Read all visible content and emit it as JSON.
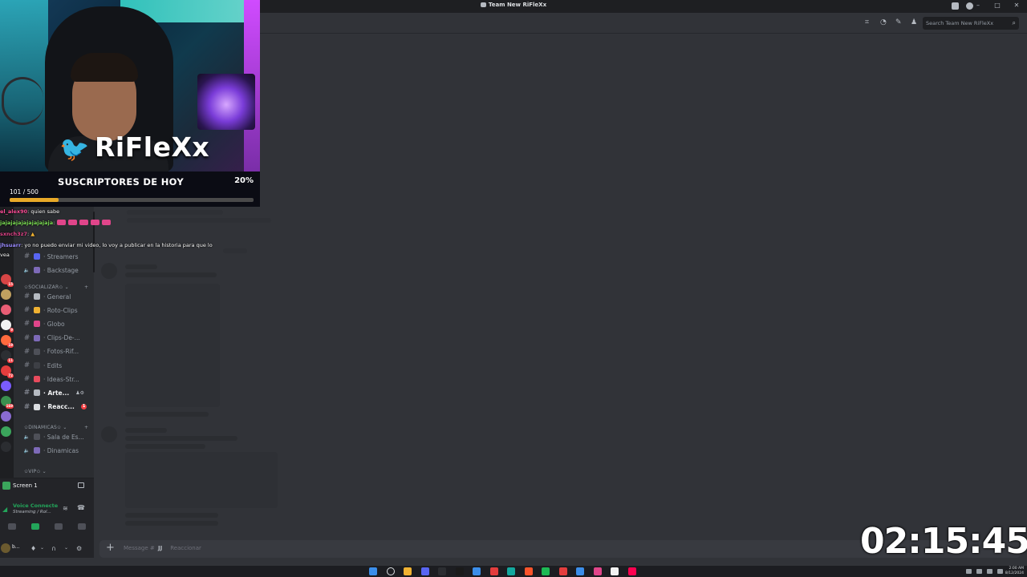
{
  "window": {
    "title": "Team New RiFleXx",
    "minimize_glyph": "–",
    "maximize_glyph": "□",
    "close_glyph": "✕"
  },
  "header": {
    "search_placeholder": "Search Team New RiFleXx",
    "icons": [
      "threads-icon",
      "bell-icon",
      "pin-icon",
      "members-icon"
    ]
  },
  "stream_overlay": {
    "handle": "RiFleXx",
    "sub_goal_title": "SUSCRIPTORES DE HOY",
    "sub_goal_count": "101 / 500",
    "sub_goal_percent": "20%",
    "sub_goal_fraction": 0.2
  },
  "twitch_chat": [
    {
      "user": "el_alex90",
      "text": ": quien sabe",
      "color": "#ff4f9a"
    },
    {
      "user": "jajajajajajajajajaja",
      "text": ":",
      "color": "#7cdc55"
    },
    {
      "user": "sxnch3z7",
      "text": ":",
      "color": "#e0458a"
    },
    {
      "user": "jhsuarr",
      "text": ": yo no puedo enviar mi video, lo voy a publicar en la historia para que lo",
      "color": "#9b8cff"
    },
    {
      "user": "",
      "text": "vea",
      "color": "#ffffff"
    }
  ],
  "sidebar": {
    "top_items": [
      {
        "name": "Streamers",
        "type": "text",
        "color": "#5865f2"
      },
      {
        "name": "Backstage",
        "type": "voice",
        "color": "#7d6ab8"
      }
    ],
    "categories": [
      {
        "label": "✩SOCIALIZAR✩",
        "channels": [
          {
            "name": "General",
            "type": "text",
            "color": "#b5bac1"
          },
          {
            "name": "Roto-Clips",
            "type": "text",
            "color": "#f0b232"
          },
          {
            "name": "Globo",
            "type": "text",
            "color": "#e0458a"
          },
          {
            "name": "Clips-De-...",
            "type": "text",
            "color": "#7d6ab8"
          },
          {
            "name": "Fotos-Rif...",
            "type": "text",
            "color": "#4e5058"
          },
          {
            "name": "Edits",
            "type": "text",
            "color": "#3d3f45"
          },
          {
            "name": "Ideas-Str...",
            "type": "text",
            "color": "#e84b5d"
          },
          {
            "name": "Arte...",
            "type": "text",
            "color": "#b5bac1",
            "active": true
          },
          {
            "name": "Reacc...",
            "type": "text",
            "color": "#dbdee1",
            "active": true,
            "unread": "1"
          }
        ]
      },
      {
        "label": "✩DINAMICAS✩",
        "channels": [
          {
            "name": "Sala de Es...",
            "type": "voice",
            "color": "#4e5058"
          },
          {
            "name": "Dinamicas",
            "type": "voice",
            "color": "#7d6ab8"
          }
        ]
      }
    ],
    "collapsed_category": "✩VIP✩"
  },
  "servers": [
    {
      "color": "#d64545",
      "badge": "15"
    },
    {
      "color": "#c0a060",
      "badge": ""
    },
    {
      "color": "#e85d75",
      "badge": ""
    },
    {
      "color": "#f2f2f2",
      "badge": "9"
    },
    {
      "color": "#ff6a3d",
      "badge": "19"
    },
    {
      "color": "#2c2f33",
      "badge": "11"
    },
    {
      "color": "#e33d3d",
      "badge": "72"
    },
    {
      "color": "#7a5cff",
      "badge": ""
    },
    {
      "color": "#3a8f4f",
      "badge": "169"
    },
    {
      "color": "#8a6bd1",
      "badge": ""
    },
    {
      "color": "#3ba55c",
      "badge": ""
    },
    {
      "color": "#2b2d31",
      "badge": ""
    }
  ],
  "voice": {
    "screen_label": "Screen 1",
    "status": "Voice Connecte",
    "detail": "Streaming / Rol..."
  },
  "user": {
    "name": "b..."
  },
  "composer": {
    "placeholder": "Message #",
    "channel_emoji": "JJ",
    "channel_name": "Reaccionar"
  },
  "timer": {
    "text": "02:15:45"
  },
  "taskbar": {
    "clock_time": "2:00 AM",
    "clock_date": "8/12/2024",
    "apps": [
      "#3b8eea",
      "#dbdee1",
      "#f0b232",
      "#5865f2",
      "#2b2d31",
      "#1a1a1a",
      "#3b8eea",
      "#e33d3d",
      "#13a89e",
      "#fb542b",
      "#1db954",
      "#e33d3d",
      "#3b8eea",
      "#e0458a",
      "#f2f2f2",
      "#ff0050"
    ]
  }
}
